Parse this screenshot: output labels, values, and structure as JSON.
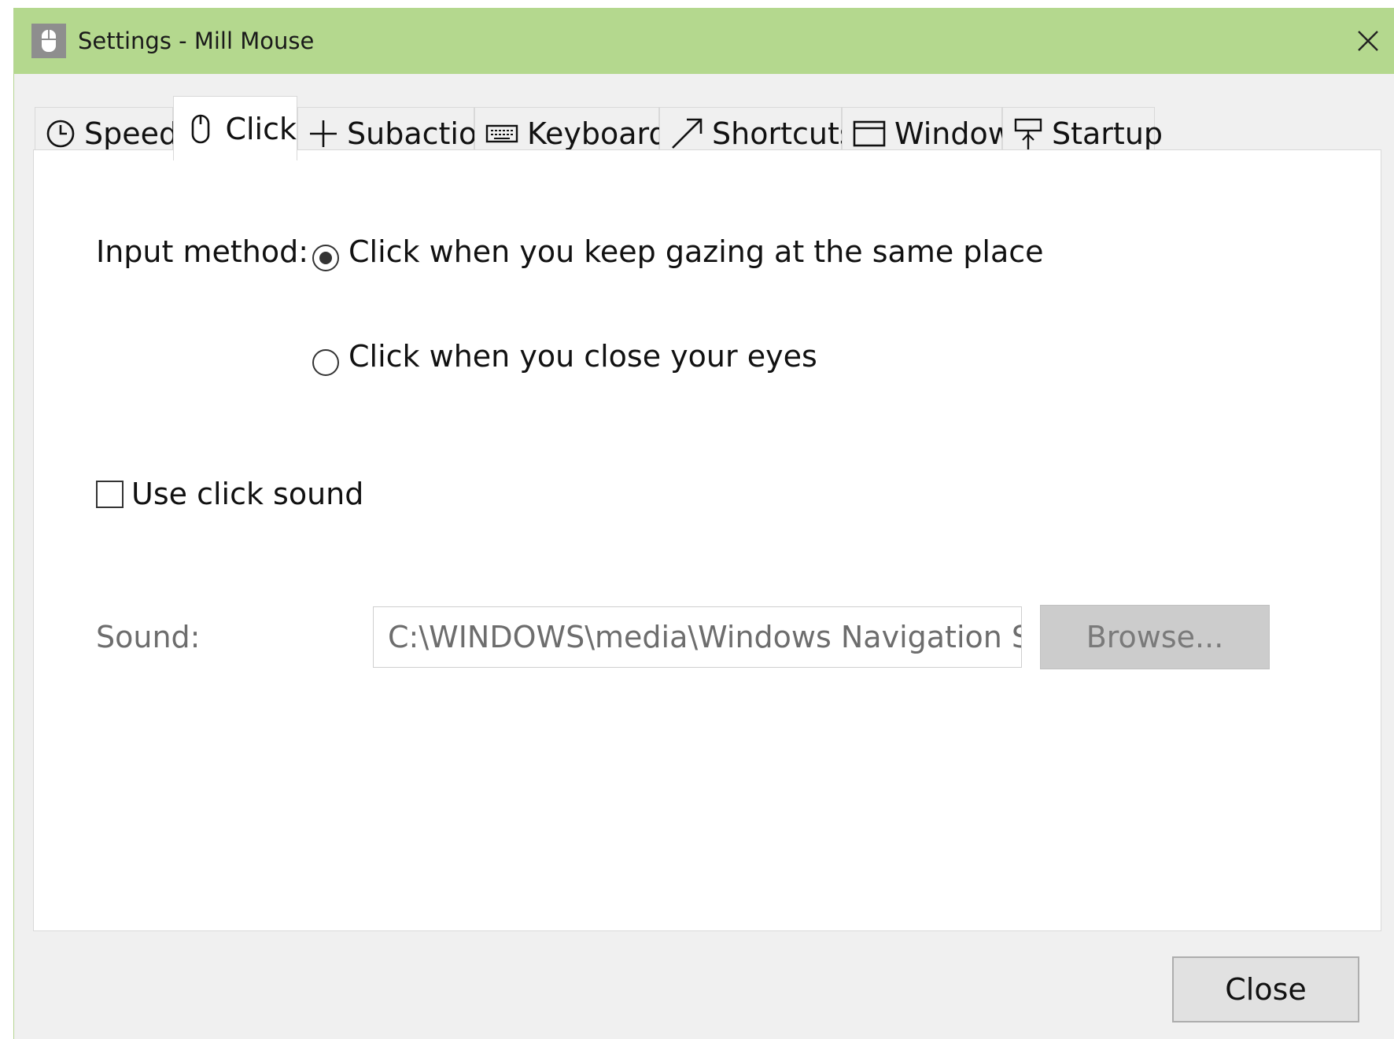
{
  "window": {
    "title": "Settings - Mill Mouse",
    "accent_color": "#b4d88e",
    "close_glyph": "×"
  },
  "tabs": [
    {
      "label": "Speed",
      "icon": "clock-icon"
    },
    {
      "label": "Click",
      "icon": "mouse-icon",
      "active": true
    },
    {
      "label": "Subaction",
      "icon": "plus-icon"
    },
    {
      "label": "Keyboard",
      "icon": "keyboard-icon"
    },
    {
      "label": "Shortcuts",
      "icon": "arrow-diagonal-icon"
    },
    {
      "label": "Window",
      "icon": "window-icon"
    },
    {
      "label": "Startup",
      "icon": "signpost-icon"
    }
  ],
  "click_panel": {
    "input_method_label": "Input method:",
    "radio_options": [
      {
        "label": "Click when you keep gazing at the same place",
        "selected": true
      },
      {
        "label": "Click when you close your eyes",
        "selected": false
      }
    ],
    "use_click_sound": {
      "label": "Use click sound",
      "checked": false
    },
    "sound": {
      "label": "Sound:",
      "value": "C:\\WINDOWS\\media\\Windows Navigation Start.wav",
      "browse_label": "Browse..."
    }
  },
  "footer": {
    "close_label": "Close"
  }
}
